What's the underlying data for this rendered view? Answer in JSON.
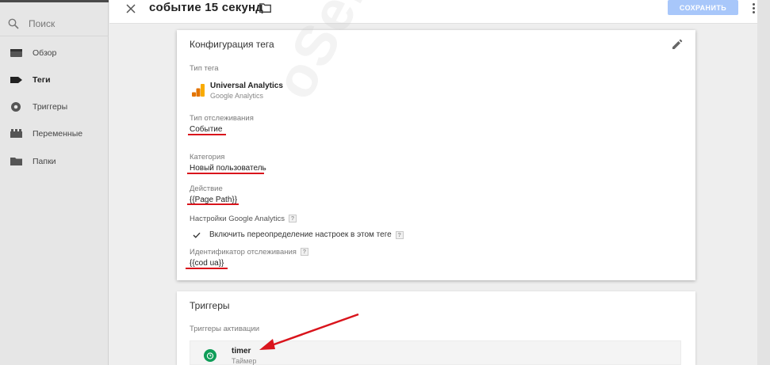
{
  "header": {
    "tag_name": "событие 15 секунд",
    "save_label": "СОХРАНИТЬ"
  },
  "sidebar": {
    "search_placeholder": "Поиск",
    "items": [
      {
        "label": "Обзор",
        "icon": "overview-icon"
      },
      {
        "label": "Теги",
        "icon": "tag-icon",
        "active": true
      },
      {
        "label": "Триггеры",
        "icon": "trigger-icon"
      },
      {
        "label": "Переменные",
        "icon": "variables-icon"
      },
      {
        "label": "Папки",
        "icon": "folder-icon"
      }
    ]
  },
  "tag_config": {
    "title": "Конфигурация тега",
    "tag_type_label": "Тип тега",
    "tag_type_name": "Universal Analytics",
    "tag_type_vendor": "Google Analytics",
    "track_type_label": "Тип отслеживания",
    "track_type_value": "Событие",
    "category_label": "Категория",
    "category_value": "Новый пользователь",
    "action_label": "Действие",
    "action_value": "{{Page Path}}",
    "ga_settings_label": "Настройки Google Analytics",
    "override_label": "Включить переопределение настроек в этом теге",
    "tracking_id_label": "Идентификатор отслеживания",
    "tracking_id_value": "{{cod ua}}"
  },
  "triggers": {
    "title": "Триггеры",
    "subtitle": "Триггеры активации",
    "items": [
      {
        "name": "timer",
        "type": "Таймер",
        "icon": "timer-icon"
      }
    ]
  },
  "watermark": "oSend",
  "colors": {
    "accent": "#a8c7fa",
    "highlight": "#d9141c",
    "trigger_icon": "#0f9d58",
    "ga_orange": "#f9ab00",
    "ga_dark_orange": "#e37400"
  }
}
